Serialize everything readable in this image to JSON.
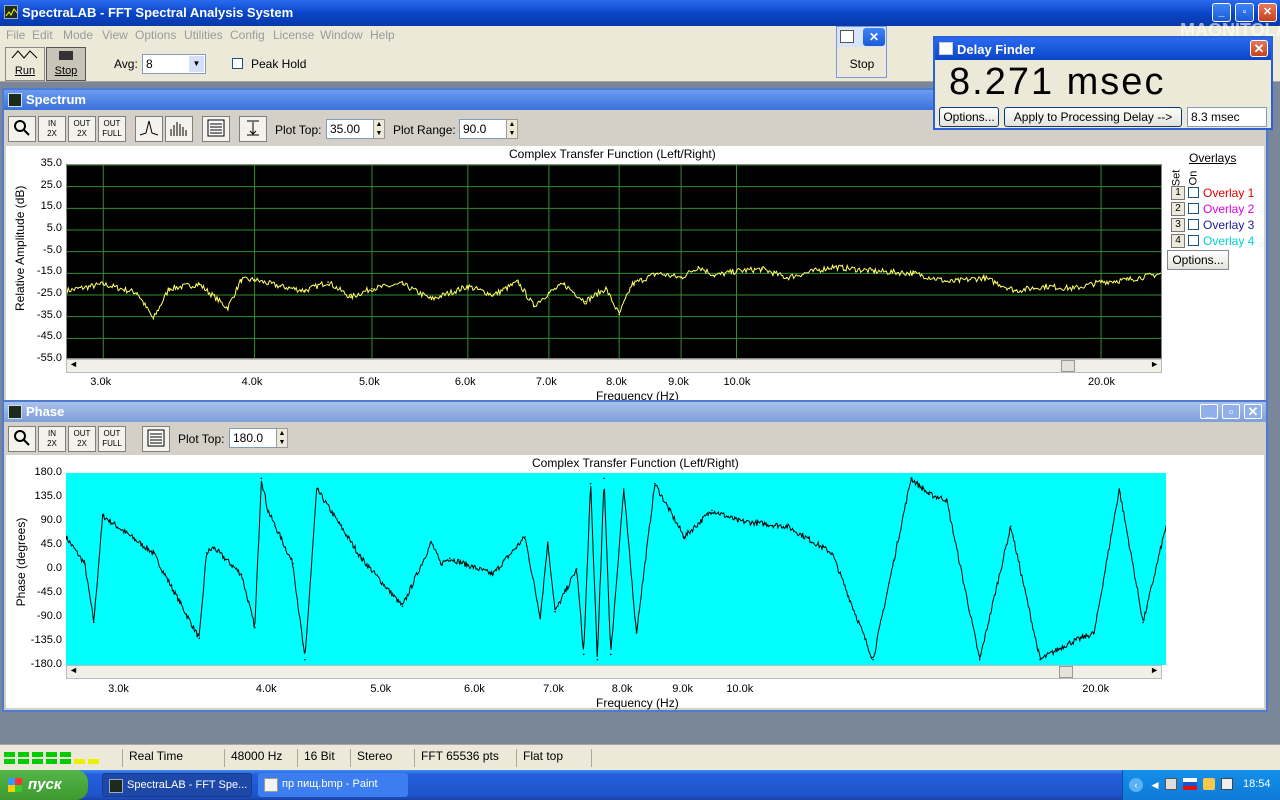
{
  "app": {
    "title": "SpectraLAB - FFT Spectral Analysis System",
    "watermark": "MAGNITOLA"
  },
  "menu": [
    "File",
    "Edit",
    "Mode",
    "View",
    "Options",
    "Utilities",
    "Config",
    "License",
    "Window",
    "Help"
  ],
  "toolbar": {
    "run_label": "Run",
    "stop_label": "Stop",
    "avg_label": "Avg:",
    "avg_value": "8",
    "peak_hold_label": "Peak Hold",
    "peak_hold_checked": false
  },
  "stop_popup": {
    "stop_label": "Stop"
  },
  "delay_finder": {
    "title": "Delay Finder",
    "value": "8.271 msec",
    "options_label": "Options...",
    "apply_label": "Apply to Processing Delay -->",
    "result_value": "8.3 msec"
  },
  "spectrum": {
    "title": "Spectrum",
    "plot_top_label": "Plot Top:",
    "plot_top_value": "35.00",
    "plot_range_label": "Plot Range:",
    "plot_range_value": "90.0",
    "overlays_header": "Overlays",
    "set_label": "Set",
    "on_label": "On",
    "overlays": [
      {
        "num": "1",
        "label": "Overlay 1",
        "color": "#e00000"
      },
      {
        "num": "2",
        "label": "Overlay 2",
        "color": "#e000e0"
      },
      {
        "num": "3",
        "label": "Overlay 3",
        "color": "#1a1aa0"
      },
      {
        "num": "4",
        "label": "Overlay 4",
        "color": "#00d0d0"
      }
    ],
    "options_label": "Options..."
  },
  "phase": {
    "title": "Phase",
    "plot_top_label": "Plot Top:",
    "plot_top_value": "180.0"
  },
  "chart_data": [
    {
      "type": "line",
      "title": "Complex Transfer Function (Left/Right)",
      "xlabel": "Frequency (Hz)",
      "ylabel": "Relative Amplitude (dB)",
      "x_scale": "log",
      "xlim": [
        2800,
        22500
      ],
      "ylim": [
        -55,
        35
      ],
      "yticks": [
        "35.0",
        "25.0",
        "15.0",
        "5.0",
        "-5.0",
        "-15.0",
        "-25.0",
        "-35.0",
        "-45.0",
        "-55.0"
      ],
      "xticks": [
        {
          "v": 3000,
          "label": "3.0k"
        },
        {
          "v": 4000,
          "label": "4.0k"
        },
        {
          "v": 5000,
          "label": "5.0k"
        },
        {
          "v": 6000,
          "label": "6.0k"
        },
        {
          "v": 7000,
          "label": "7.0k"
        },
        {
          "v": 8000,
          "label": "8.0k"
        },
        {
          "v": 9000,
          "label": "9.0k"
        },
        {
          "v": 10000,
          "label": "10.0k"
        },
        {
          "v": 20000,
          "label": "20.0k"
        }
      ],
      "grid": true,
      "background": "#000000",
      "grid_color": "#2f8f2f",
      "line_color": "#ffff66",
      "x": [
        2800,
        3000,
        3200,
        3300,
        3400,
        3600,
        3800,
        3900,
        4000,
        4200,
        4400,
        4600,
        4800,
        5000,
        5300,
        5600,
        6000,
        6300,
        6600,
        6800,
        7000,
        7200,
        7500,
        7800,
        8000,
        8200,
        8600,
        9000,
        9300,
        9600,
        10000,
        10500,
        11000,
        12000,
        13000,
        14000,
        15000,
        16000,
        17000,
        18000,
        19000,
        20000,
        21000,
        22500
      ],
      "y": [
        -23,
        -20,
        -24,
        -36,
        -22,
        -20,
        -31,
        -18,
        -18,
        -21,
        -23,
        -19,
        -26,
        -22,
        -20,
        -27,
        -21,
        -25,
        -19,
        -30,
        -24,
        -20,
        -28,
        -22,
        -34,
        -20,
        -15,
        -17,
        -12,
        -16,
        -14,
        -13,
        -17,
        -12,
        -14,
        -15,
        -19,
        -17,
        -23,
        -21,
        -22,
        -19,
        -18,
        -15
      ]
    },
    {
      "type": "line",
      "title": "Complex Transfer Function (Left/Right)",
      "xlabel": "Frequency (Hz)",
      "ylabel": "Phase (degrees)",
      "x_scale": "log",
      "xlim": [
        2700,
        23000
      ],
      "ylim": [
        -180,
        180
      ],
      "yticks": [
        "180.0",
        "135.0",
        "90.0",
        "45.0",
        "0.0",
        "-45.0",
        "-90.0",
        "-135.0",
        "-180.0"
      ],
      "xticks": [
        {
          "v": 3000,
          "label": "3.0k"
        },
        {
          "v": 4000,
          "label": "4.0k"
        },
        {
          "v": 5000,
          "label": "5.0k"
        },
        {
          "v": 6000,
          "label": "6.0k"
        },
        {
          "v": 7000,
          "label": "7.0k"
        },
        {
          "v": 8000,
          "label": "8.0k"
        },
        {
          "v": 9000,
          "label": "9.0k"
        },
        {
          "v": 10000,
          "label": "10.0k"
        },
        {
          "v": 20000,
          "label": "20.0k"
        }
      ],
      "grid": false,
      "background": "#00ffff",
      "line_color": "#000000",
      "x": [
        2700,
        2800,
        2850,
        2900,
        3200,
        3500,
        3550,
        3600,
        3800,
        3900,
        3950,
        4000,
        4200,
        4300,
        4400,
        4800,
        5200,
        5500,
        5600,
        5700,
        6200,
        6600,
        6800,
        6900,
        7000,
        7300,
        7400,
        7500,
        7600,
        7700,
        7800,
        8000,
        8200,
        8500,
        9000,
        9500,
        10000,
        11000,
        12000,
        13000,
        14000,
        14500,
        15000,
        16000,
        17000,
        18000,
        19000,
        20000,
        21000,
        22000,
        23000
      ],
      "y": [
        60,
        10,
        -100,
        100,
        30,
        -130,
        30,
        40,
        -10,
        -110,
        170,
        110,
        10,
        -170,
        150,
        20,
        -70,
        50,
        10,
        20,
        -10,
        60,
        -90,
        50,
        -80,
        0,
        -160,
        160,
        -170,
        170,
        -160,
        150,
        -120,
        160,
        60,
        110,
        90,
        80,
        30,
        -170,
        170,
        140,
        130,
        -170,
        80,
        -170,
        -140,
        -120,
        150,
        -100,
        80
      ]
    }
  ],
  "status": {
    "mode": "Real Time",
    "rate": "48000 Hz",
    "bits": "16 Bit",
    "channels": "Stereo",
    "fft": "FFT 65536 pts",
    "window": "Flat top"
  },
  "taskbar": {
    "start_label": "пуск",
    "tasks": [
      "SpectraLAB - FFT Spe...",
      "пр пищ.bmp - Paint"
    ],
    "clock": "18:54"
  }
}
